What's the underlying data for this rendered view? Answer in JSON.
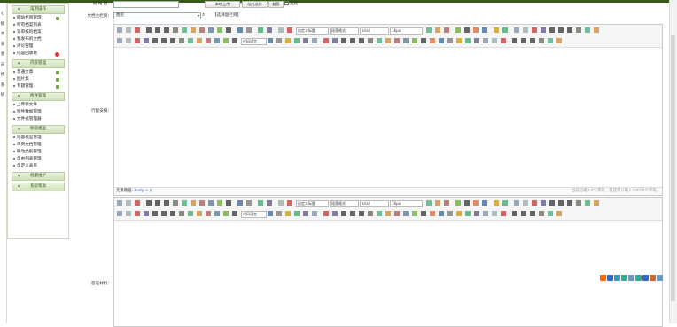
{
  "left_strip": [
    "心",
    "模",
    "主",
    "系",
    "会",
    "员",
    "模",
    "系",
    "统"
  ],
  "sidebar": {
    "sections": [
      {
        "title": "常用操作",
        "items": [
          "网站栏目管理",
          "所有档案列表",
          "等审核的档案",
          "我发布的文档",
          "评论管理",
          "内容回收站"
        ]
      },
      {
        "title": "内容管理",
        "items": [
          "普通文章",
          "图片集",
          "专题管理"
        ]
      },
      {
        "title": "附件管理",
        "items": [
          "上传新文件",
          "附件数据管理",
          "文件式管理器"
        ]
      },
      {
        "title": "频道模型",
        "items": [
          "内容模型管理",
          "单页文档管理",
          "联动类别管理",
          "自由列表管理",
          "自定义表单"
        ]
      },
      {
        "title": "批量维护",
        "items": []
      },
      {
        "title": "系统帮助",
        "items": []
      }
    ]
  },
  "form": {
    "thumb_label": "缩 略 图：",
    "upload_button": "本地上传",
    "site_select_button": "站内选择",
    "crop_button": "裁剪",
    "remote_label": "远程",
    "main_column_label": "文档主栏目：",
    "main_column_value": "图组",
    "select_subcolumn": "【选择副栏目】",
    "trip_label": "行程安排：",
    "visa_label": "签证材料："
  },
  "editor": {
    "font_family": "自定义标题",
    "para_format": "段落格式",
    "font_name": "arial",
    "font_size": "16px",
    "code_lang": "代码语言",
    "path_label": "元素路径:",
    "path_value": "body > p",
    "char_count": "当前已输入0个字符，您还可以输入10000个字符。"
  }
}
